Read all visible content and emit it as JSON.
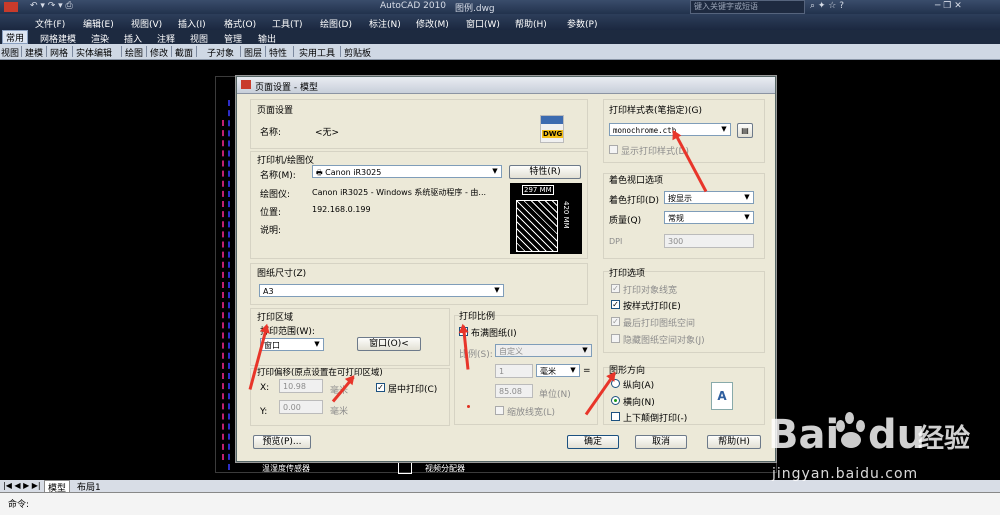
{
  "app": {
    "title_center": "AutoCAD 2010",
    "file": "图例.dwg",
    "search_placeholder": "键入关键字或短语"
  },
  "menu": [
    "文件(F)",
    "编辑(E)",
    "视图(V)",
    "插入(I)",
    "格式(O)",
    "工具(T)",
    "绘图(D)",
    "标注(N)",
    "修改(M)",
    "窗口(W)",
    "帮助(H)",
    "参数(P)"
  ],
  "ribbon_tabs": [
    "常用",
    "网格建模",
    "渲染",
    "插入",
    "注释",
    "视图",
    "管理",
    "输出"
  ],
  "toolbar_items": [
    "视图",
    "建模",
    "网格",
    "实体编辑",
    "绘图",
    "修改",
    "截面",
    "子对象",
    "图层",
    "特性",
    "实用工具",
    "剪贴板"
  ],
  "drawing": {
    "label1": "温湿度传感器",
    "label2": "视频分配器"
  },
  "bottom_tabs": {
    "model": "模型",
    "layout": "布局1"
  },
  "command_prompt": "命令:",
  "dialog": {
    "title": "页面设置 - 模型",
    "page_setup": {
      "heading": "页面设置",
      "name_label": "名称:",
      "name_value": "<无>",
      "dwg_icon_text": "DWG"
    },
    "printer": {
      "heading": "打印机/绘图仪",
      "name_label": "名称(M):",
      "name_value": "Canon iR3025",
      "properties_button": "特性(R)",
      "plotter_label": "绘图仪:",
      "plotter_value": "Canon iR3025 - Windows 系统驱动程序 - 由...",
      "where_label": "位置:",
      "where_value": "192.168.0.199",
      "desc_label": "说明:",
      "preview_width": "297 MM",
      "preview_height": "420 MM"
    },
    "paper_size": {
      "heading": "图纸尺寸(Z)",
      "value": "A3"
    },
    "plot_area": {
      "heading": "打印区域",
      "what_label": "打印范围(W):",
      "what_value": "窗口",
      "window_button": "窗口(O)<"
    },
    "plot_offset": {
      "heading": "打印偏移(原点设置在可打印区域)",
      "x_label": "X:",
      "x_value": "10.98",
      "x_unit": "毫米",
      "y_label": "Y:",
      "y_value": "0.00",
      "y_unit": "毫米",
      "center_label": "居中打印(C)",
      "center_checked": true
    },
    "plot_scale": {
      "heading": "打印比例",
      "fit_label": "布满图纸(I)",
      "fit_checked": true,
      "scale_label": "比例(S):",
      "scale_value": "自定义",
      "value1": "1",
      "unit_value": "毫米",
      "eq": "=",
      "value2": "85.08",
      "unit2": "单位(N)",
      "lineweights_label": "缩放线宽(L)"
    },
    "plot_style_table": {
      "heading": "打印样式表(笔指定)(G)",
      "value": "monochrome.ctb",
      "display_label": "显示打印样式(D)"
    },
    "shaded_viewport": {
      "heading": "着色视口选项",
      "shade_label": "着色打印(D)",
      "shade_value": "按显示",
      "quality_label": "质量(Q)",
      "quality_value": "常规",
      "dpi_label": "DPI",
      "dpi_value": "300"
    },
    "plot_options": {
      "heading": "打印选项",
      "items": [
        {
          "label": "打印对象线宽",
          "checked": true,
          "enabled": false
        },
        {
          "label": "按样式打印(E)",
          "checked": true,
          "enabled": true
        },
        {
          "label": "最后打印图纸空间",
          "checked": true,
          "enabled": false
        },
        {
          "label": "隐藏图纸空间对象(J)",
          "checked": false,
          "enabled": false
        }
      ]
    },
    "orientation": {
      "heading": "图形方向",
      "portrait": "纵向(A)",
      "landscape": "横向(N)",
      "upside_down": "上下颠倒打印(-)",
      "selected": "landscape"
    },
    "buttons": {
      "preview": "预览(P)...",
      "ok": "确定",
      "cancel": "取消",
      "help": "帮助(H)"
    }
  },
  "watermark": {
    "brand_en": "Bai",
    "brand_du": "du",
    "brand_cn": "经验",
    "url": "jingyan.baidu.com"
  },
  "colors": {
    "arrow_red": "#e8352a",
    "dialog_bg": "#ece9d8",
    "cad_bg": "#000000"
  }
}
